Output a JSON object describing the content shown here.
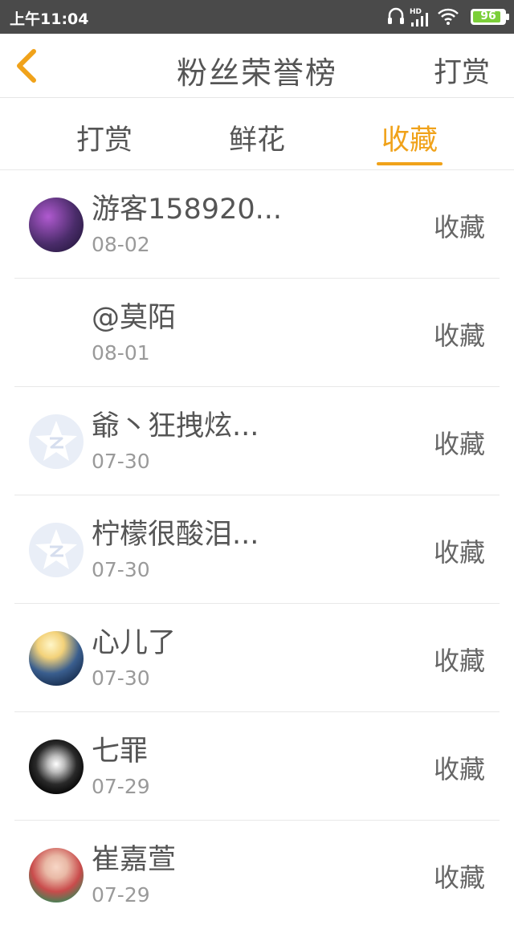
{
  "status_bar": {
    "time": "上午11:04",
    "battery": "96",
    "icons": [
      "headphones-icon",
      "hd-signal-icon",
      "wifi-icon",
      "battery-icon"
    ]
  },
  "header": {
    "back_icon": "chevron-left-icon",
    "title": "粉丝荣誉榜",
    "right_action": "打赏"
  },
  "tabs": [
    {
      "label": "打赏",
      "active": false
    },
    {
      "label": "鲜花",
      "active": false
    },
    {
      "label": "收藏",
      "active": true
    }
  ],
  "accent_color": "#f0a21a",
  "list": [
    {
      "name": "游客158920...",
      "date": "08-02",
      "action": "收藏",
      "avatar": "photo"
    },
    {
      "name": "@莫陌",
      "date": "08-01",
      "action": "收藏",
      "avatar": "none"
    },
    {
      "name": "爺丶狂拽炫...",
      "date": "07-30",
      "action": "收藏",
      "avatar": "default-star"
    },
    {
      "name": "柠檬很酸泪...",
      "date": "07-30",
      "action": "收藏",
      "avatar": "default-star"
    },
    {
      "name": "心儿了",
      "date": "07-30",
      "action": "收藏",
      "avatar": "photo"
    },
    {
      "name": "七罪",
      "date": "07-29",
      "action": "收藏",
      "avatar": "photo"
    },
    {
      "name": "崔嘉萱",
      "date": "07-29",
      "action": "收藏",
      "avatar": "photo"
    }
  ]
}
